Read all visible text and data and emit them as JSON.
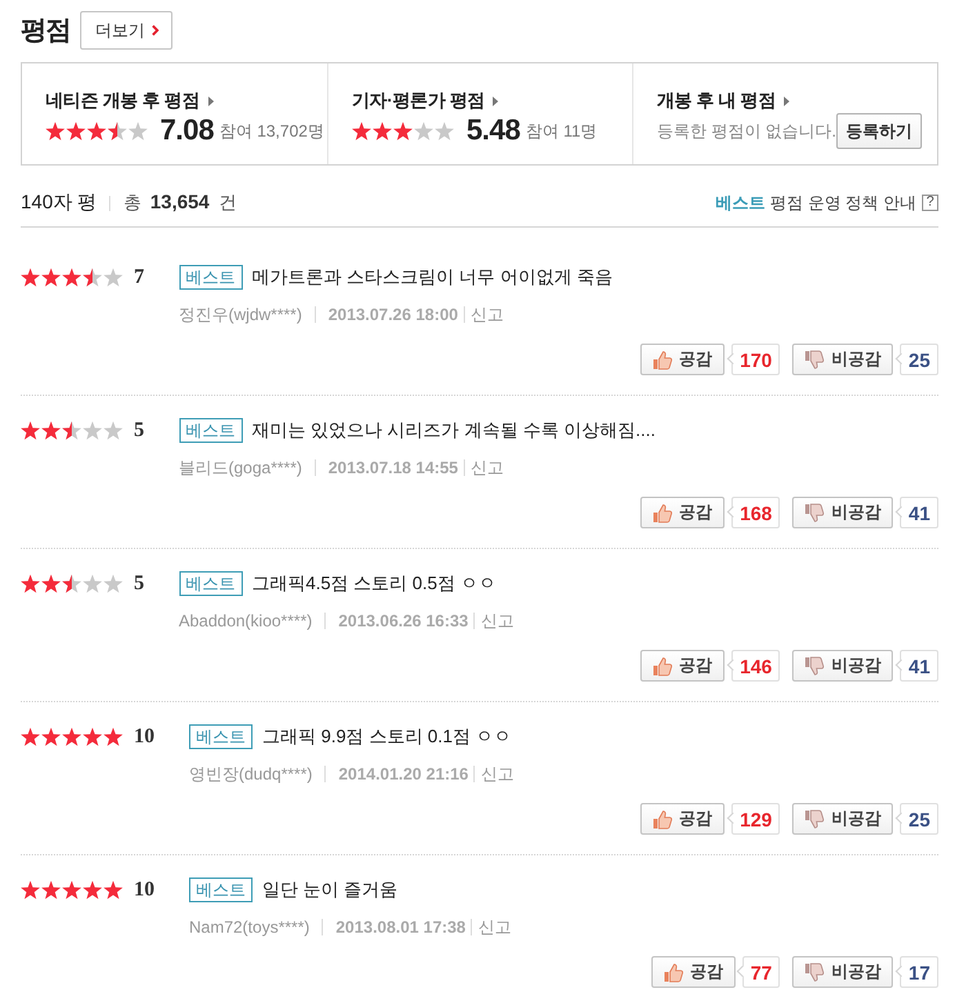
{
  "header": {
    "title": "평점",
    "more_button": "더보기"
  },
  "summary": [
    {
      "kind": "rating",
      "label": "네티즌 개봉 후 평점",
      "stars": 3.5,
      "score": "7.08",
      "participants": "참여 13,702명"
    },
    {
      "kind": "rating",
      "label": "기자·평론가 평점",
      "stars": 3,
      "score": "5.48",
      "participants": "참여 11명"
    },
    {
      "kind": "mine",
      "label": "개봉 후 내 평점",
      "message": "등록한 평점이 없습니다.",
      "button": "등록하기"
    }
  ],
  "toolbar": {
    "title": "140자 평",
    "total": "총 **13,654** 건",
    "policy": "**베스트** 평점 운영 정책 안내",
    "help": "?"
  },
  "reviews": [
    {
      "stars": 3.5,
      "score": "7",
      "badge": "베스트",
      "text": "메가트론과 스타스크림이 너무 어이없게 죽음",
      "author": "정진우(wjdw****)",
      "date": "2013.07.26 18:00",
      "report": "신고",
      "like_label": "공감",
      "likes": "170",
      "dislike_label": "비공감",
      "dislikes": "25"
    },
    {
      "stars": 2.5,
      "score": "5",
      "badge": "베스트",
      "text": "재미는 있었으나 시리즈가 계속될 수록 이상해짐....",
      "author": "블리드(goga****)",
      "date": "2013.07.18 14:55",
      "report": "신고",
      "like_label": "공감",
      "likes": "168",
      "dislike_label": "비공감",
      "dislikes": "41"
    },
    {
      "stars": 2.5,
      "score": "5",
      "badge": "베스트",
      "text": "그래픽4.5점 스토리 0.5점 ㅇㅇ",
      "author": "Abaddon(kioo****)",
      "date": "2013.06.26 16:33",
      "report": "신고",
      "like_label": "공감",
      "likes": "146",
      "dislike_label": "비공감",
      "dislikes": "41"
    },
    {
      "stars": 5,
      "score": "10",
      "badge": "베스트",
      "text": "그래픽 9.9점 스토리 0.1점 ㅇㅇ",
      "author": "영빈장(dudq****)",
      "date": "2014.01.20 21:16",
      "report": "신고",
      "like_label": "공감",
      "likes": "129",
      "dislike_label": "비공감",
      "dislikes": "25"
    },
    {
      "stars": 5,
      "score": "10",
      "badge": "베스트",
      "text": "일단 눈이 즐거움",
      "author": "Nam72(toys****)",
      "date": "2013.08.01 17:38",
      "report": "신고",
      "like_label": "공감",
      "likes": "77",
      "dislike_label": "비공감",
      "dislikes": "17"
    }
  ]
}
